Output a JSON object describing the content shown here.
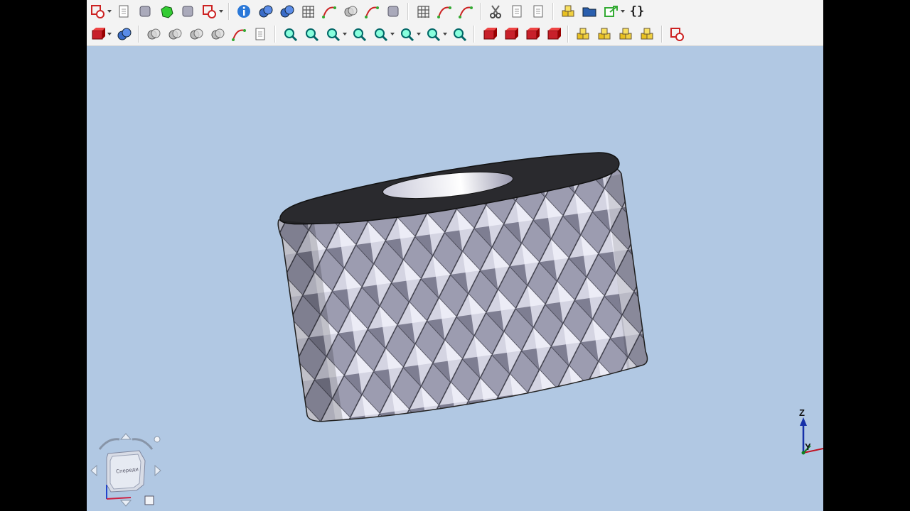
{
  "toolbar_row1": [
    {
      "name": "new-part-icon",
      "dropdown": true
    },
    {
      "name": "check-geometry-icon"
    },
    {
      "name": "chess-pawn-icon"
    },
    {
      "name": "green-puzzle-icon"
    },
    {
      "name": "head-profile-icon"
    },
    {
      "name": "diamond-sketch-icon",
      "dropdown": true
    },
    {
      "sep": true
    },
    {
      "name": "info-icon"
    },
    {
      "name": "measure-icon"
    },
    {
      "name": "spheres-icon"
    },
    {
      "name": "grid-icon"
    },
    {
      "name": "bspline-curve-icon"
    },
    {
      "name": "circles-icon"
    },
    {
      "name": "attach-icon"
    },
    {
      "name": "fire-sphere-icon"
    },
    {
      "sep": true
    },
    {
      "name": "stack-arrow-icon"
    },
    {
      "name": "curve-points-icon"
    },
    {
      "name": "surface-icon"
    },
    {
      "sep": true
    },
    {
      "name": "cut-icon"
    },
    {
      "name": "copy-icon"
    },
    {
      "name": "paste-icon"
    },
    {
      "sep": true
    },
    {
      "name": "part-design-icon"
    },
    {
      "name": "folder-icon"
    },
    {
      "name": "export-icon",
      "dropdown": true
    },
    {
      "name": "macro-braces-icon",
      "text": "{}"
    }
  ],
  "toolbar_row2": [
    {
      "name": "red-cube-icon",
      "dropdown": true
    },
    {
      "name": "boolean-icon"
    },
    {
      "sep": true
    },
    {
      "name": "union-icon"
    },
    {
      "name": "intersection-icon"
    },
    {
      "name": "cut-shapes-icon"
    },
    {
      "name": "fillet-icon"
    },
    {
      "name": "mirror-icon"
    },
    {
      "name": "check-icon"
    },
    {
      "sep": true
    },
    {
      "name": "zoom-all-icon"
    },
    {
      "name": "zoom-selection-icon"
    },
    {
      "name": "isometric-view-icon",
      "dropdown": true
    },
    {
      "name": "view-direction-icon"
    },
    {
      "name": "draw-style-icon",
      "dropdown": true
    },
    {
      "name": "bounding-box-icon",
      "dropdown": true
    },
    {
      "name": "zoom-icon",
      "dropdown": true
    },
    {
      "name": "measure-tool-icon"
    },
    {
      "sep": true
    },
    {
      "name": "extrude-icon"
    },
    {
      "name": "revolve-icon"
    },
    {
      "name": "loft-icon"
    },
    {
      "name": "sweep-icon"
    },
    {
      "sep": true
    },
    {
      "name": "array-icon"
    },
    {
      "name": "chain-icon"
    },
    {
      "name": "compound-icon"
    },
    {
      "name": "yellow-blocks-icon"
    },
    {
      "sep": true
    },
    {
      "name": "refine-icon"
    }
  ],
  "nav_cube": {
    "face_label": "Спереди"
  },
  "axis": {
    "z_label": "Z",
    "y_label": "Y"
  },
  "colors": {
    "background": "#b1c8e3",
    "toolbar": "#f3f3f3",
    "model_face": "#b7b7c9",
    "model_top": "#2a2a2e"
  }
}
